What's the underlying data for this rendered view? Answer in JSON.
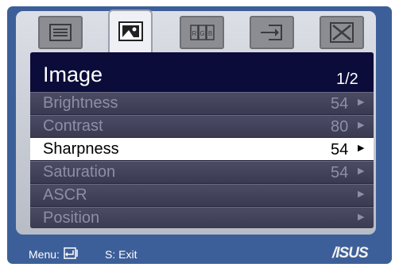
{
  "menu": {
    "title": "Image",
    "page": "1/2",
    "items": [
      {
        "label": "Brightness",
        "value": "54",
        "arrow": "▶",
        "selected": false
      },
      {
        "label": "Contrast",
        "value": "80",
        "arrow": "▶",
        "selected": false
      },
      {
        "label": "Sharpness",
        "value": "54",
        "arrow": "▶",
        "selected": true
      },
      {
        "label": "Saturation",
        "value": "54",
        "arrow": "▶",
        "selected": false
      },
      {
        "label": "ASCR",
        "value": "",
        "arrow": "▶",
        "selected": false
      },
      {
        "label": "Position",
        "value": "",
        "arrow": "▶",
        "selected": false
      }
    ]
  },
  "tabs": [
    {
      "icon": "splendid-icon",
      "active": false
    },
    {
      "icon": "image-icon",
      "active": true
    },
    {
      "icon": "rgb-color-icon",
      "active": false,
      "text": "R G B"
    },
    {
      "icon": "input-select-icon",
      "active": false
    },
    {
      "icon": "system-setup-icon",
      "active": false
    }
  ],
  "footer": {
    "menu_label": "Menu:",
    "exit_label": "S: Exit",
    "brand": "/ISUS"
  },
  "colors": {
    "frame": "#3d5f99",
    "header": "#0c0c3a",
    "selected_row": "#ffffff",
    "inactive_text": "#8d8fa6"
  }
}
